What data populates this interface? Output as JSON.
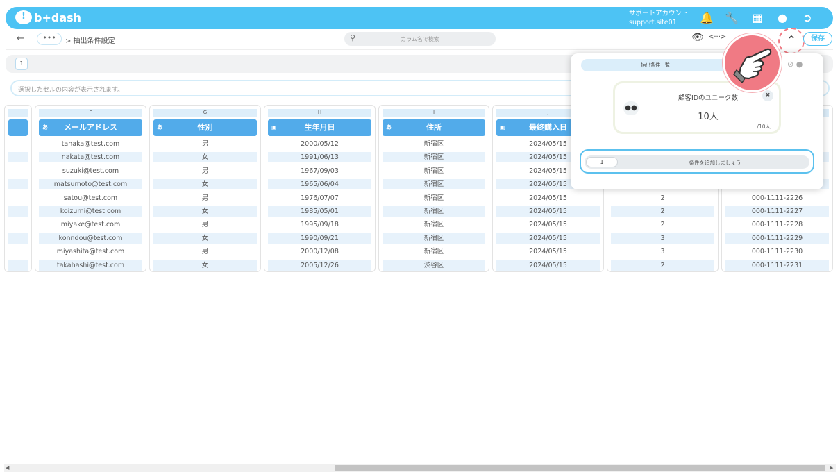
{
  "header": {
    "logo_text": "b+dash",
    "account_name": "サポートアカウント",
    "account_id": "support.site01",
    "brand_color": "#4dc3f4"
  },
  "nav": {
    "back_symbol": "←",
    "more_symbol": "•••",
    "breadcrumb": "> 抽出条件設定",
    "search_placeholder": "カラム名で検索",
    "code_symbol": "<···>",
    "save_label": "保存"
  },
  "sheet": {
    "tab_number": "1",
    "cell_info_placeholder": "選択したセルの内容が表示されます。"
  },
  "columns": [
    {
      "letter": "",
      "header": "",
      "type_icon": "",
      "values": [
        "",
        "",
        "",
        "",
        "",
        "",
        "",
        "",
        "",
        ""
      ]
    },
    {
      "letter": "F",
      "header": "メールアドレス",
      "type_icon": "あ",
      "values": [
        "tanaka@test.com",
        "nakata@test.com",
        "suzuki@test.com",
        "matsumoto@test.com",
        "satou@test.com",
        "koizumi@test.com",
        "miyake@test.com",
        "konndou@test.com",
        "miyashita@test.com",
        "takahashi@test.com"
      ]
    },
    {
      "letter": "G",
      "header": "性別",
      "type_icon": "あ",
      "values": [
        "男",
        "女",
        "男",
        "女",
        "男",
        "女",
        "男",
        "女",
        "男",
        "女"
      ]
    },
    {
      "letter": "H",
      "header": "生年月日",
      "type_icon": "calendar",
      "values": [
        "2000/05/12",
        "1991/06/13",
        "1967/09/03",
        "1965/06/04",
        "1976/07/07",
        "1985/05/01",
        "1995/09/18",
        "1990/09/21",
        "2000/12/08",
        "2005/12/26"
      ]
    },
    {
      "letter": "I",
      "header": "住所",
      "type_icon": "あ",
      "values": [
        "新宿区",
        "新宿区",
        "新宿区",
        "新宿区",
        "新宿区",
        "新宿区",
        "新宿区",
        "新宿区",
        "新宿区",
        "渋谷区"
      ]
    },
    {
      "letter": "J",
      "header": "最終購入日",
      "type_icon": "calendar",
      "values": [
        "2024/05/15",
        "2024/05/15",
        "2024/05/15",
        "2024/05/15",
        "2024/05/15",
        "2024/05/15",
        "2024/05/15",
        "2024/05/15",
        "2024/05/15",
        "2024/05/15"
      ]
    },
    {
      "letter": "",
      "header": "",
      "type_icon": "",
      "values": [
        "",
        "",
        "",
        "",
        "2",
        "2",
        "2",
        "3",
        "3",
        "2"
      ]
    },
    {
      "letter": "",
      "header": "",
      "type_icon": "",
      "values": [
        "",
        "",
        "",
        "",
        "000-1111-2226",
        "000-1111-2227",
        "000-1111-2228",
        "000-1111-2229",
        "000-1111-2230",
        "000-1111-2231"
      ]
    }
  ],
  "panel": {
    "tab_label": "抽出条件一覧",
    "card_title": "顧客IDのユニーク数",
    "card_value": "10人",
    "card_sub": "/10人",
    "condition_number": "1",
    "condition_placeholder": "条件を追加しましょう"
  }
}
